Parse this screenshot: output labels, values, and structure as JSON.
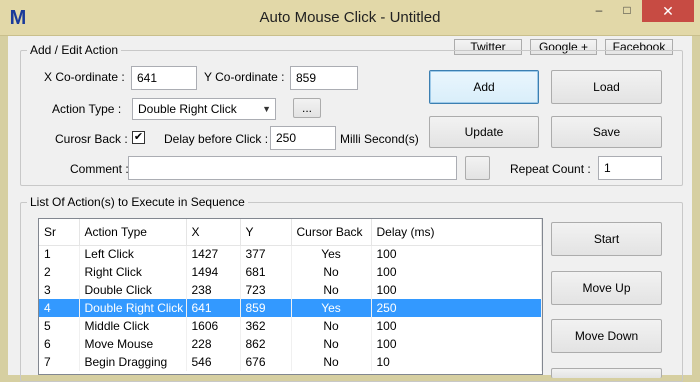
{
  "window": {
    "title": "Auto Mouse Click - Untitled",
    "app_icon_letter": "M",
    "minimize_glyph": "–",
    "maximize_glyph": "□",
    "close_glyph": "✕"
  },
  "social": {
    "twitter": "Twitter",
    "google": "Google +",
    "facebook": "Facebook"
  },
  "edit": {
    "legend": "Add / Edit Action",
    "x_label": "X Co-ordinate :",
    "x_value": "641",
    "y_label": "Y Co-ordinate :",
    "y_value": "859",
    "action_type_label": "Action Type :",
    "action_type_value": "Double Right Click",
    "browse_label": "...",
    "cursor_back_label": "Curosr Back :",
    "cursor_back_checked": true,
    "cursor_back_glyph": "✔",
    "delay_label": "Delay before Click :",
    "delay_value": "250",
    "delay_unit": "Milli Second(s)",
    "comment_label": "Comment :",
    "comment_value": "",
    "repeat_label": "Repeat Count :",
    "repeat_value": "1"
  },
  "buttons": {
    "add": "Add",
    "load": "Load",
    "update": "Update",
    "save": "Save",
    "start": "Start",
    "move_up": "Move Up",
    "move_down": "Move Down"
  },
  "list": {
    "legend": "List Of Action(s) to Execute in Sequence",
    "columns": [
      "Sr",
      "Action Type",
      "X",
      "Y",
      "Cursor Back",
      "Delay (ms)"
    ],
    "selected_index": 3,
    "rows": [
      [
        "1",
        "Left Click",
        "1427",
        "377",
        "Yes",
        "100"
      ],
      [
        "2",
        "Right Click",
        "1494",
        "681",
        "No",
        "100"
      ],
      [
        "3",
        "Double Click",
        "238",
        "723",
        "No",
        "100"
      ],
      [
        "4",
        "Double Right Click",
        "641",
        "859",
        "Yes",
        "250"
      ],
      [
        "5",
        "Middle Click",
        "1606",
        "362",
        "No",
        "100"
      ],
      [
        "6",
        "Move Mouse",
        "228",
        "862",
        "No",
        "100"
      ],
      [
        "7",
        "Begin Dragging",
        "546",
        "676",
        "No",
        "10"
      ]
    ]
  },
  "colors": {
    "title_bar": "#e2d8a8",
    "selection": "#3399ff",
    "close_button": "#c74b43"
  }
}
